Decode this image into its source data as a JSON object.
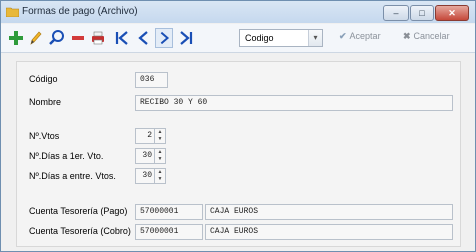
{
  "window": {
    "title": "Formas de pago (Archivo)",
    "buttons": {
      "minimize": "–",
      "maximize": "□",
      "close": "✕"
    }
  },
  "toolbar": {
    "search_field": "Codigo",
    "accept_label": "Aceptar",
    "cancel_label": "Cancelar",
    "icons": [
      "add-icon",
      "edit-icon",
      "search-icon",
      "delete-icon",
      "print-icon",
      "first-icon",
      "prev-icon",
      "next-icon",
      "last-icon"
    ]
  },
  "form": {
    "codigo": {
      "label": "Código",
      "value": "036"
    },
    "nombre": {
      "label": "Nombre",
      "value": "RECIBO 30 Y 60"
    },
    "nvtos": {
      "label": "Nº.Vtos",
      "value": "2"
    },
    "dias_primer": {
      "label": "Nº.Días a 1er. Vto.",
      "value": "30"
    },
    "dias_entre": {
      "label": "Nº.Días a entre. Vtos.",
      "value": "30"
    },
    "tesoreria_pago": {
      "label": "Cuenta Tesorería (Pago)",
      "cuenta": "57000001",
      "nombre": "CAJA EUROS"
    },
    "tesoreria_cobro": {
      "label": "Cuenta Tesorería (Cobro)",
      "cuenta": "57000001",
      "nombre": "CAJA EUROS"
    }
  },
  "colors": {
    "add": "#2e9b3a",
    "edit": "#e0a21a",
    "accent": "#1a4fb5",
    "delete": "#d23a3a"
  }
}
